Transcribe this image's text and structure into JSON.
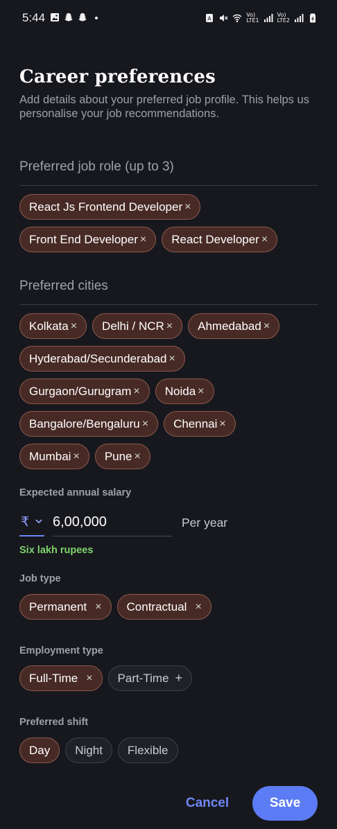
{
  "status_bar": {
    "time": "5:44",
    "volte1": "Vo)\nLTE1",
    "volte2": "Vo)\nLTE2"
  },
  "page": {
    "title": "Career preferences",
    "subtitle": "Add details about your preferred job profile. This helps us personalise your job recommendations."
  },
  "job_roles": {
    "label": "Preferred job role (up to 3)",
    "items": [
      "React Js Frontend Developer",
      "Front End Developer",
      "React Developer"
    ]
  },
  "cities": {
    "label": "Preferred cities",
    "items": [
      "Kolkata",
      "Delhi / NCR",
      "Ahmedabad",
      "Hyderabad/Secunderabad",
      "Gurgaon/Gurugram",
      "Noida",
      "Bangalore/Bengaluru",
      "Chennai",
      "Mumbai",
      "Pune"
    ]
  },
  "salary": {
    "label": "Expected annual salary",
    "currency_symbol": "₹",
    "value": "6,00,000",
    "period": "Per year",
    "in_words": "Six lakh rupees"
  },
  "job_type": {
    "label": "Job type",
    "items": [
      "Permanent",
      "Contractual"
    ]
  },
  "employment_type": {
    "label": "Employment type",
    "selected": "Full-Time",
    "unselected": "Part-Time"
  },
  "shift": {
    "label": "Preferred shift",
    "selected": "Day",
    "options": [
      "Night",
      "Flexible"
    ]
  },
  "actions": {
    "cancel": "Cancel",
    "save": "Save"
  },
  "icons": {
    "remove": "×",
    "add": "+",
    "dropdown": "⌄"
  },
  "colors": {
    "background": "#17181d",
    "chip_selected_bg": "#472a25",
    "chip_selected_border": "#8d5a4f",
    "accent": "#5c7cf5",
    "success_text": "#7ed26c"
  }
}
